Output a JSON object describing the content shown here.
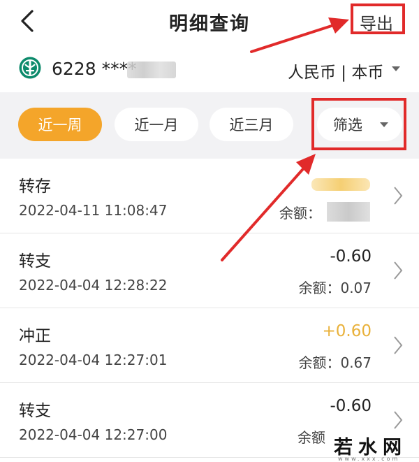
{
  "header": {
    "title": "明细查询",
    "export_label": "导出",
    "back_icon": "chevron-left-icon"
  },
  "account": {
    "number_visible": "6228 ****",
    "currency": "人民币 | 本币",
    "bank_icon": "bank-logo-icon"
  },
  "filters": {
    "tabs": [
      {
        "label": "近一周",
        "active": true
      },
      {
        "label": "近一月",
        "active": false
      },
      {
        "label": "近三月",
        "active": false
      }
    ],
    "filter_label": "筛选"
  },
  "transactions": [
    {
      "type": "转存",
      "datetime": "2022-04-11 11:08:47",
      "amount": "",
      "balance_label": "余额：",
      "balance": ""
    },
    {
      "type": "转支",
      "datetime": "2022-04-04 12:28:22",
      "amount": "-0.60",
      "balance_label": "余额：",
      "balance": "0.07"
    },
    {
      "type": "冲正",
      "datetime": "2022-04-04 12:27:01",
      "amount": "+0.60",
      "balance_label": "余额：",
      "balance": "0.67"
    },
    {
      "type": "转支",
      "datetime": "2022-04-04 12:27:00",
      "amount": "-0.60",
      "balance_label": "余额",
      "balance": ""
    }
  ],
  "watermark": {
    "text": "若水网",
    "sub": "www.xxx.com"
  },
  "colors": {
    "accent": "#f4a52a",
    "positive": "#e9b13a",
    "annotation": "#e12a2a",
    "filter_bg": "#f2f2f4"
  }
}
